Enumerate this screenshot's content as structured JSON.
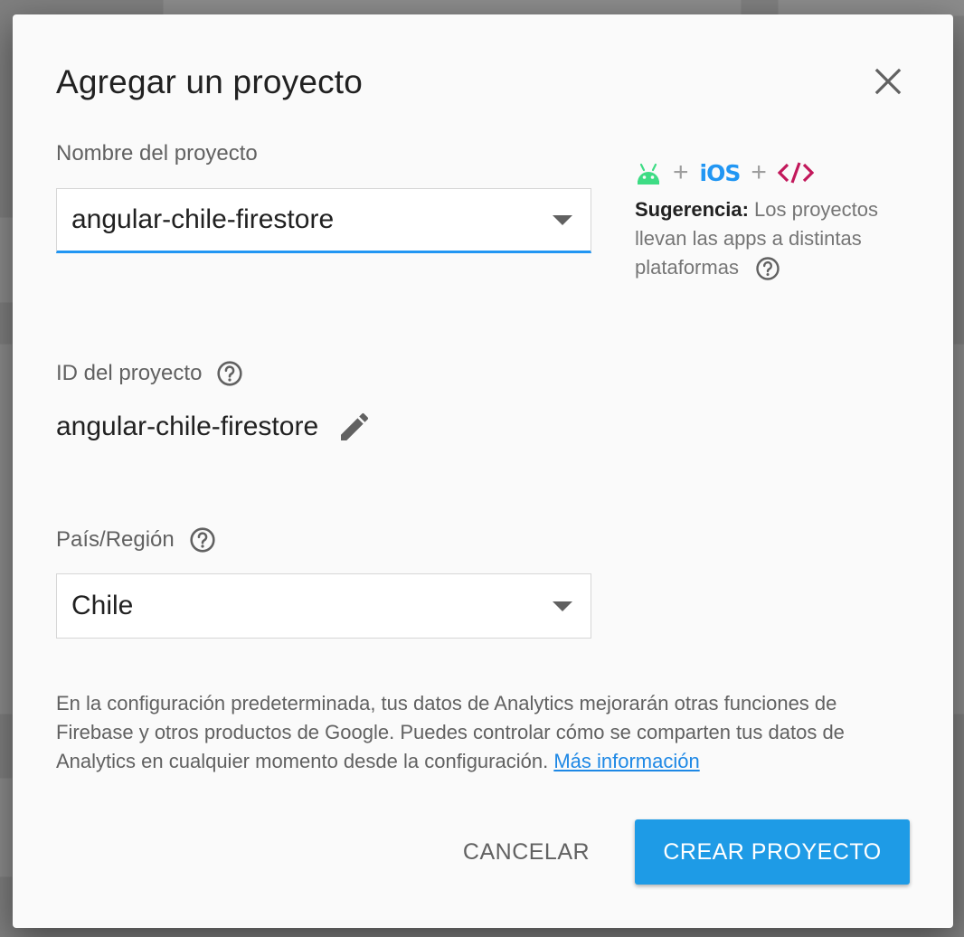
{
  "colors": {
    "accent": "#2196f3",
    "primary_button": "#1e9be6",
    "android": "#3ddc84",
    "ios": "#2196f3",
    "web": "#c2185b"
  },
  "dialog": {
    "title": "Agregar un proyecto",
    "close_icon": "close-icon"
  },
  "project_name": {
    "label": "Nombre del proyecto",
    "value": "angular-chile-firestore"
  },
  "project_id": {
    "label": "ID del proyecto",
    "value": "angular-chile-firestore",
    "edit_icon": "pencil-icon"
  },
  "region": {
    "label": "País/Región",
    "value": "Chile"
  },
  "platforms": {
    "ios_label": "iOS",
    "plus": "+",
    "web_label": "</>"
  },
  "tip": {
    "bold": "Sugerencia:",
    "text": " Los proyectos llevan las apps a distintas plataformas"
  },
  "analytics": {
    "text": "En la configuración predeterminada, tus datos de Analytics mejorarán otras funciones de Firebase y otros productos de Google. Puedes controlar cómo se comparten tus datos de Analytics en cualquier momento desde la configuración. ",
    "link": "Más información"
  },
  "buttons": {
    "cancel": "CANCELAR",
    "create": "CREAR PROYECTO"
  }
}
